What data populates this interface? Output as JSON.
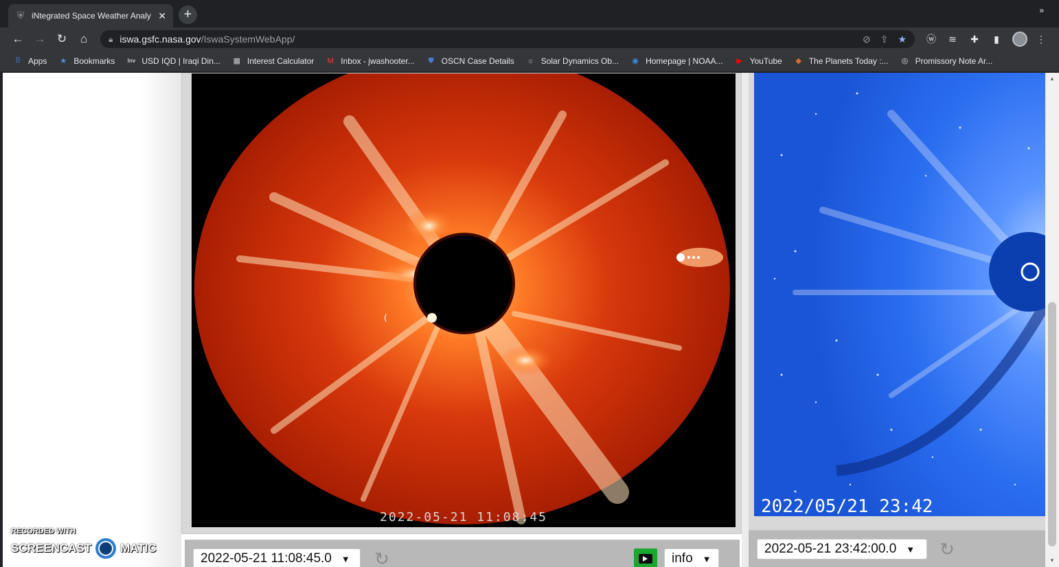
{
  "browser": {
    "tab_title": "iNtegrated Space Weather Analy",
    "tab_close": "✕",
    "new_tab": "+",
    "url_host": "iswa.gsfc.nasa.gov",
    "url_path": "/IswaSystemWebApp/"
  },
  "bookmarks": [
    {
      "label": "Apps",
      "icon": "apps-grid-icon",
      "color": "#4285f4"
    },
    {
      "label": "Bookmarks",
      "icon": "star-icon",
      "color": "#4f8fe6"
    },
    {
      "label": "USD IQD | Iraqi Din...",
      "icon": "inv-icon",
      "color": "#cccccc"
    },
    {
      "label": "Interest Calculator",
      "icon": "calculator-icon",
      "color": "#cccccc"
    },
    {
      "label": "Inbox - jwashooter...",
      "icon": "gmail-icon",
      "color": "#ea4335"
    },
    {
      "label": "OSCN Case Details",
      "icon": "shield-icon",
      "color": "#4a7bd0"
    },
    {
      "label": "Solar Dynamics Ob...",
      "icon": "sdo-icon",
      "color": "#bbbbbb"
    },
    {
      "label": "Homepage | NOAA...",
      "icon": "noaa-icon",
      "color": "#3f8de0"
    },
    {
      "label": "YouTube",
      "icon": "youtube-icon",
      "color": "#ff0000"
    },
    {
      "label": "The Planets Today :...",
      "icon": "planets-icon",
      "color": "#e06a30"
    },
    {
      "label": "Promissory Note Ar...",
      "icon": "note-icon",
      "color": "#dddddd"
    }
  ],
  "bookmarks_more": "»",
  "panels": {
    "c2": {
      "timestamp": "2022-05-21  11:08:45",
      "select_value": "2022-05-21 11:08:45.0",
      "info_label": "info"
    },
    "c3": {
      "timestamp": "2022/05/21  23:42",
      "select_value": "2022-05-21 23:42:00.0"
    }
  },
  "watermark": {
    "line1": "RECORDED WITH",
    "line2a": "SCREENCAST",
    "line2b": "MATIC"
  }
}
